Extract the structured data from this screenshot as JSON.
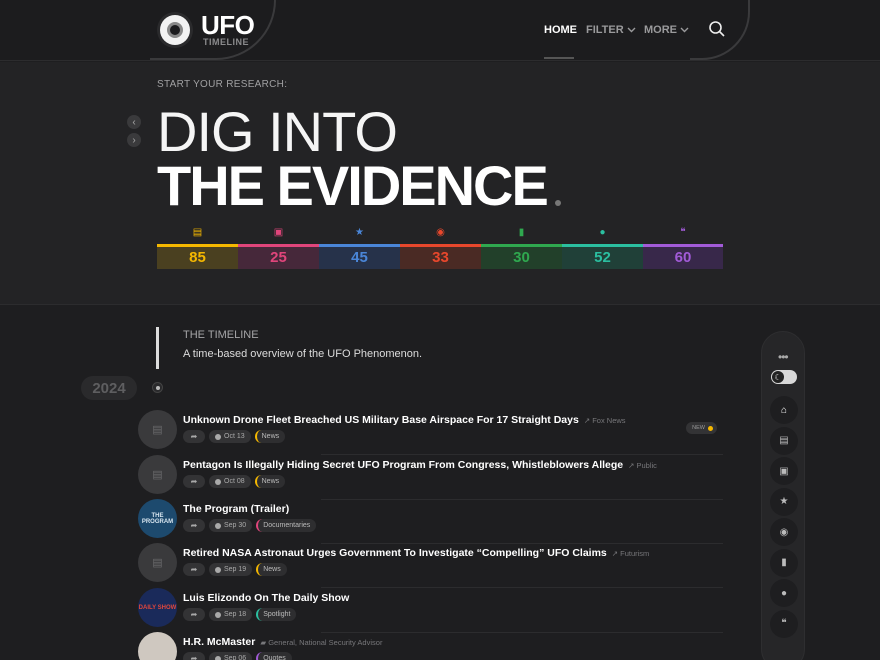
{
  "brand": {
    "title": "UFO",
    "subtitle": "TIMELINE"
  },
  "nav": {
    "home": "HOME",
    "filter": "FILTER",
    "more": "MORE"
  },
  "hero": {
    "kicker": "START YOUR RESEARCH:",
    "line1": "DIG INTO",
    "line2": "THE EVIDENCE"
  },
  "stats": [
    {
      "icon": "news-icon",
      "value": "85",
      "color": "#f5b800",
      "dim": "#4a4020"
    },
    {
      "icon": "film-icon",
      "value": "25",
      "color": "#e0457b",
      "dim": "#46283a"
    },
    {
      "icon": "star-icon",
      "value": "45",
      "color": "#4a86d8",
      "dim": "#26324a"
    },
    {
      "icon": "eye-icon",
      "value": "33",
      "color": "#e8472c",
      "dim": "#4a2a24"
    },
    {
      "icon": "book-icon",
      "value": "30",
      "color": "#2fa84f",
      "dim": "#22402a"
    },
    {
      "icon": "flame-icon",
      "value": "52",
      "color": "#2bbfa0",
      "dim": "#204038"
    },
    {
      "icon": "quote-icon",
      "value": "60",
      "color": "#a25bd8",
      "dim": "#38284a"
    }
  ],
  "timeline": {
    "title": "THE TIMELINE",
    "description": "A time-based overview of the UFO Phenomenon.",
    "year": "2024"
  },
  "entries": [
    {
      "title": "Unknown Drone Fleet Breached US Military Base Airspace For 17 Straight Days",
      "source": "Fox News",
      "date": "Oct 13",
      "category": "News",
      "cat_color": "#f5b800",
      "badge": "NEW"
    },
    {
      "title": "Pentagon Is Illegally Hiding Secret UFO Program From Congress, Whistleblowers Allege",
      "source": "Public",
      "date": "Oct 08",
      "category": "News",
      "cat_color": "#f5b800"
    },
    {
      "title": "The Program (Trailer)",
      "source": "",
      "date": "Sep 30",
      "category": "Documentaries",
      "cat_color": "#e0457b",
      "avatar_text": "THE PROGRAM"
    },
    {
      "title": "Retired NASA Astronaut Urges Government To Investigate “Compelling” UFO Claims",
      "source": "Futurism",
      "date": "Sep 19",
      "category": "News",
      "cat_color": "#f5b800"
    },
    {
      "title": "Luis Elizondo On The Daily Show",
      "source": "",
      "date": "Sep 18",
      "category": "Spotlight",
      "cat_color": "#2bbfa0",
      "avatar_text": "DAILY SHOW"
    },
    {
      "title": "H.R. McMaster",
      "source": "General, National Security Advisor",
      "date": "Sep 06",
      "category": "Quotes",
      "cat_color": "#a25bd8"
    }
  ],
  "sidebar": {
    "buttons": [
      "home-icon",
      "news-icon",
      "film-icon",
      "star-icon",
      "eye-icon",
      "book-icon",
      "flame-icon",
      "quote-icon"
    ]
  }
}
